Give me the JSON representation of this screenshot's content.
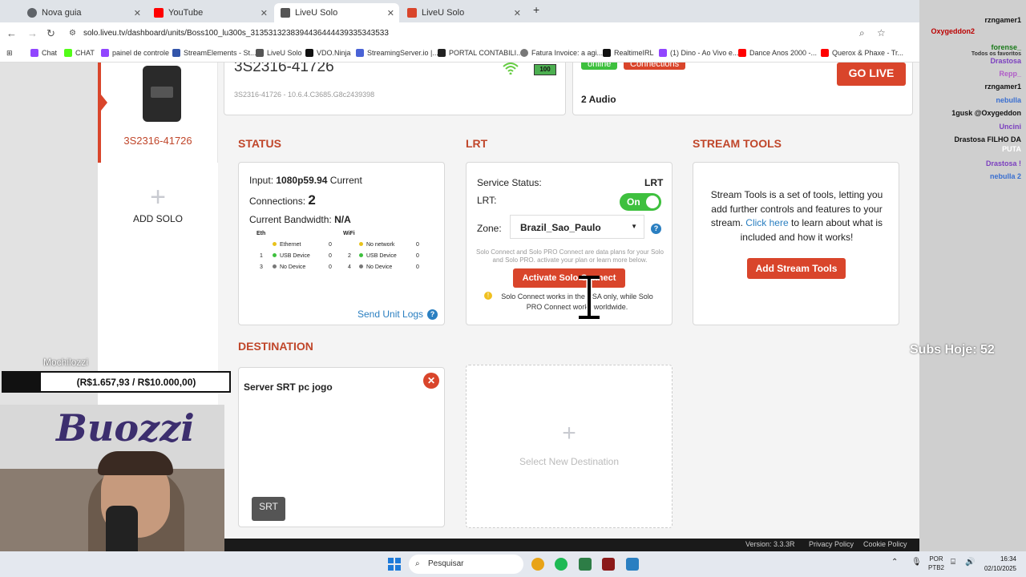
{
  "browser": {
    "tabs": [
      {
        "label": "Nova guia",
        "color": "#5f6368",
        "close": "✕"
      },
      {
        "label": "YouTube",
        "color": "#ff0000",
        "close": "✕"
      },
      {
        "label": "LiveU Solo",
        "color": "#555555",
        "close": "✕",
        "active": true
      },
      {
        "label": "LiveU Solo",
        "color": "#d9452b",
        "close": "✕"
      }
    ],
    "new_tab": "+",
    "url": "solo.liveu.tv/dashboard/units/Boss100_lu300s_3135313238394436444439335343533",
    "bookmarks": [
      "Chat",
      "CHAT",
      "painel de controle",
      "StreamElements - St...",
      "LiveU Solo",
      "VDO.Ninja",
      "StreamingServer.io |...",
      "PORTAL CONTABILI...",
      "Fatura Invoice: a agi...",
      "RealtimeIRL",
      "(1) Dino - Ao Vivo e...",
      "Dance Anos 2000 -...",
      "Querox & Phaxe - Tr..."
    ],
    "bookmarks_more": "»",
    "all_favorites": "Todos os favoritos"
  },
  "unit": {
    "name": "3S2316-41726",
    "id": "3S2316-41726",
    "version": "3S2316-41726 - 10.6.4.C3685.G8c2439398",
    "battery": "100",
    "status_pill": "online",
    "connections_pill": "Connections",
    "audio": "2 Audio",
    "go_live": "GO LIVE",
    "add_solo_plus": "+",
    "add_solo": "ADD SOLO"
  },
  "status": {
    "title": "STATUS",
    "input_label": "Input:",
    "input_value": "1080p59.94",
    "current": "Current",
    "connections_label": "Connections:",
    "connections_value": "2",
    "bandwidth_label": "Current Bandwidth:",
    "bandwidth_value": "N/A",
    "headers": {
      "eth": "Eth",
      "wifi": "WiFi"
    },
    "rows": [
      {
        "a": "",
        "b": "Ethernet",
        "c": "0",
        "d": "",
        "e": "No network",
        "f": "0"
      },
      {
        "a": "1",
        "b": "USB Device",
        "c": "0",
        "d": "2",
        "e": "USB Device",
        "f": "0"
      },
      {
        "a": "3",
        "b": "No Device",
        "c": "0",
        "d": "4",
        "e": "No Device",
        "f": "0"
      }
    ],
    "send_logs": "Send Unit Logs"
  },
  "lrt": {
    "title": "LRT",
    "service_status_label": "Service Status:",
    "service_status_value": "LRT",
    "lrt_label": "LRT:",
    "toggle": "On",
    "zone_label": "Zone:",
    "zone_value": "Brazil_Sao_Paulo",
    "note": "Solo Connect and Solo PRO Connect are data plans for your Solo and Solo PRO. activate your plan or learn more below.",
    "activate": "Activate Solo Connect",
    "warning": "Solo Connect works in the USA only, while Solo PRO Connect works worldwide."
  },
  "stream_tools": {
    "title": "STREAM TOOLS",
    "text_before": "Stream Tools is a set of tools, letting you add further controls and features to your stream.",
    "link": "Click here",
    "text_after": "to learn about what is included and how it works!",
    "button": "Add Stream Tools"
  },
  "destination": {
    "title": "DESTINATION",
    "card_name": "Server SRT pc jogo",
    "badge": "SRT",
    "new_plus": "+",
    "new_label": "Select New Destination"
  },
  "footer": {
    "version": "Version: 3.3.3R",
    "privacy": "Privacy Policy",
    "cookie": "Cookie Policy"
  },
  "overlay": {
    "chat": [
      {
        "text": "rzngamer1",
        "color": "#111111"
      },
      {
        "text": "forense_",
        "color": "#1a7a1a"
      },
      {
        "text": "Drastosa",
        "color": "#7b3fbf"
      },
      {
        "text": "Repp_",
        "color": "#b05cc8"
      },
      {
        "text": "rzngamer1",
        "color": "#111111"
      },
      {
        "text": "nebulla",
        "color": "#3a6fd0"
      },
      {
        "text": "1gusk @Oxygeddon",
        "color": "#111111"
      },
      {
        "text": "Uncini",
        "color": "#7b3fbf"
      },
      {
        "text": "Drastosa FILHO DA",
        "color": "#111111"
      },
      {
        "text": "PUTA",
        "color": "#ffffff"
      },
      {
        "text": "Drastosa !",
        "color": "#7b3fbf"
      },
      {
        "text": "nebulla 2",
        "color": "#3a6fd0"
      }
    ],
    "profile": "Oxygeddon2",
    "subs": "Subs Hoje: 52",
    "goal_name": "Mochilozzi",
    "goal_text": "(R$1.657,93 / R$10.000,00)",
    "goal_progress": 0.166,
    "brand": "Buozzi"
  },
  "taskbar": {
    "search": "Pesquisar",
    "lang1": "POR",
    "lang2": "PTB2",
    "time": "16:34",
    "date": "02/10/2025"
  },
  "colors": {
    "accent": "#d9452b",
    "green": "#3ec03e",
    "link": "#2a7fc1"
  }
}
